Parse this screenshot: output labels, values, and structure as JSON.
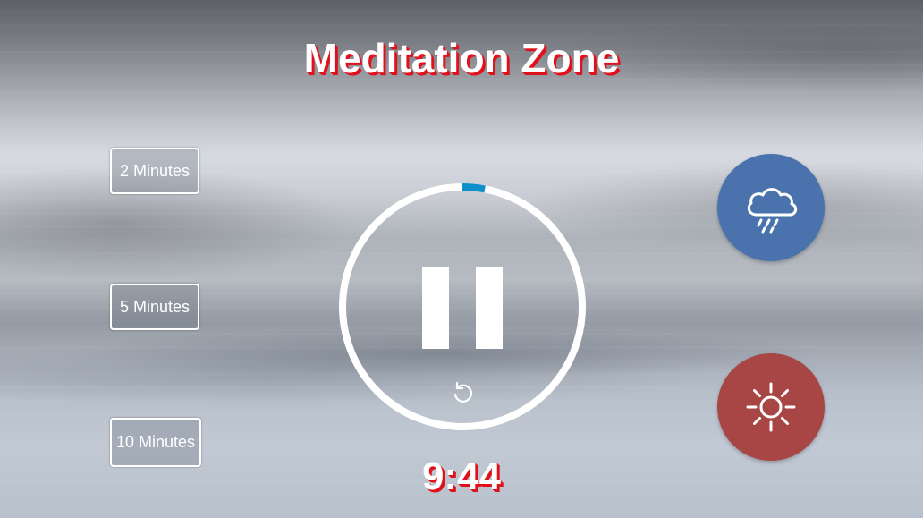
{
  "app": {
    "title": "Meditation Zone"
  },
  "durations": [
    {
      "label": "2 Minutes"
    },
    {
      "label": "5 Minutes"
    },
    {
      "label": "10 Minutes"
    }
  ],
  "timer": {
    "display": "9:44",
    "state": "playing",
    "progress_fraction": 0.03,
    "icons": {
      "toggle": "pause-icon",
      "reset": "reset-icon"
    }
  },
  "scenes": [
    {
      "name": "rain",
      "icon": "rain-cloud-icon",
      "color": "#4a73ad"
    },
    {
      "name": "sun",
      "icon": "sun-icon",
      "color": "#a84545"
    }
  ],
  "colors": {
    "title_shadow": "#e0111b",
    "ring": "#ffffff",
    "progress": "#0e8fc9"
  }
}
